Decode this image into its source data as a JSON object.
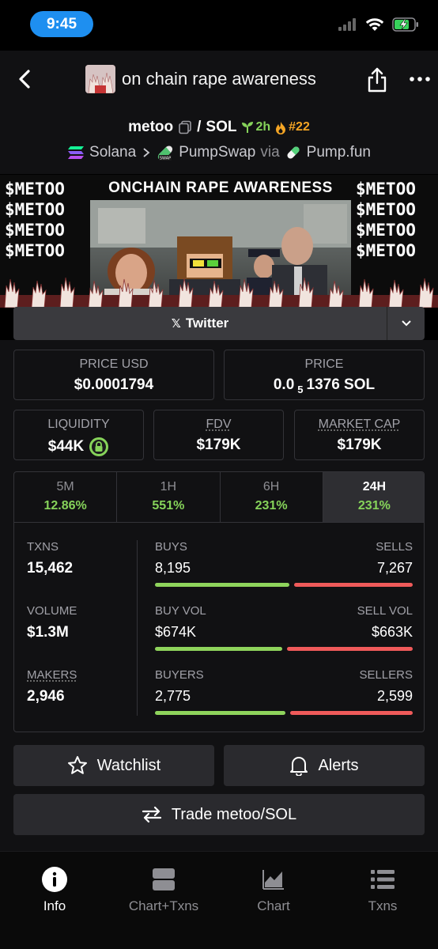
{
  "status_bar": {
    "time": "9:45"
  },
  "nav": {
    "title": "on chain rape awareness"
  },
  "token": {
    "symbol": "metoo",
    "quote": "SOL",
    "age": "2h",
    "rank": "#22",
    "chain": "Solana",
    "dex": "PumpSwap",
    "via_label": "via",
    "launchpad": "Pump.fun"
  },
  "banner": {
    "title": "ONCHAIN RAPE AWARENESS",
    "ticker": "$METOO"
  },
  "twitter": {
    "label": "Twitter"
  },
  "stats": {
    "price_usd_label": "PRICE USD",
    "price_usd": "$0.0001794",
    "price_label": "PRICE",
    "price_prefix": "0.0",
    "price_zeros": "5",
    "price_suffix": "1376 SOL",
    "liquidity_label": "LIQUIDITY",
    "liquidity": "$44K",
    "fdv_label": "FDV",
    "fdv": "$179K",
    "mcap_label": "MARKET CAP",
    "mcap": "$179K"
  },
  "timeframes": [
    {
      "label": "5M",
      "value": "12.86%"
    },
    {
      "label": "1H",
      "value": "551%"
    },
    {
      "label": "6H",
      "value": "231%"
    },
    {
      "label": "24H",
      "value": "231%"
    }
  ],
  "metrics": {
    "txns_label": "TXNS",
    "txns": "15,462",
    "volume_label": "VOLUME",
    "volume": "$1.3M",
    "makers_label": "MAKERS",
    "makers": "2,946",
    "buys_label": "BUYS",
    "buys": "8,195",
    "sells_label": "SELLS",
    "sells": "7,267",
    "buys_ratio": 0.53,
    "buyvol_label": "BUY VOL",
    "buyvol": "$674K",
    "sellvol_label": "SELL VOL",
    "sellvol": "$663K",
    "buyvol_ratio": 0.504,
    "buyers_label": "BUYERS",
    "buyers": "2,775",
    "sellers_label": "SELLERS",
    "sellers": "2,599",
    "buyers_ratio": 0.516
  },
  "actions": {
    "watchlist": "Watchlist",
    "alerts": "Alerts",
    "trade": "Trade metoo/SOL"
  },
  "tabbar": {
    "info": "Info",
    "chart_txns": "Chart+Txns",
    "chart": "Chart",
    "txns": "Txns"
  },
  "colors": {
    "accent_green": "#86d35a",
    "sell_red": "#ef5a5a",
    "status_pill": "#1e8ff0",
    "rank_orange": "#f5a524"
  }
}
